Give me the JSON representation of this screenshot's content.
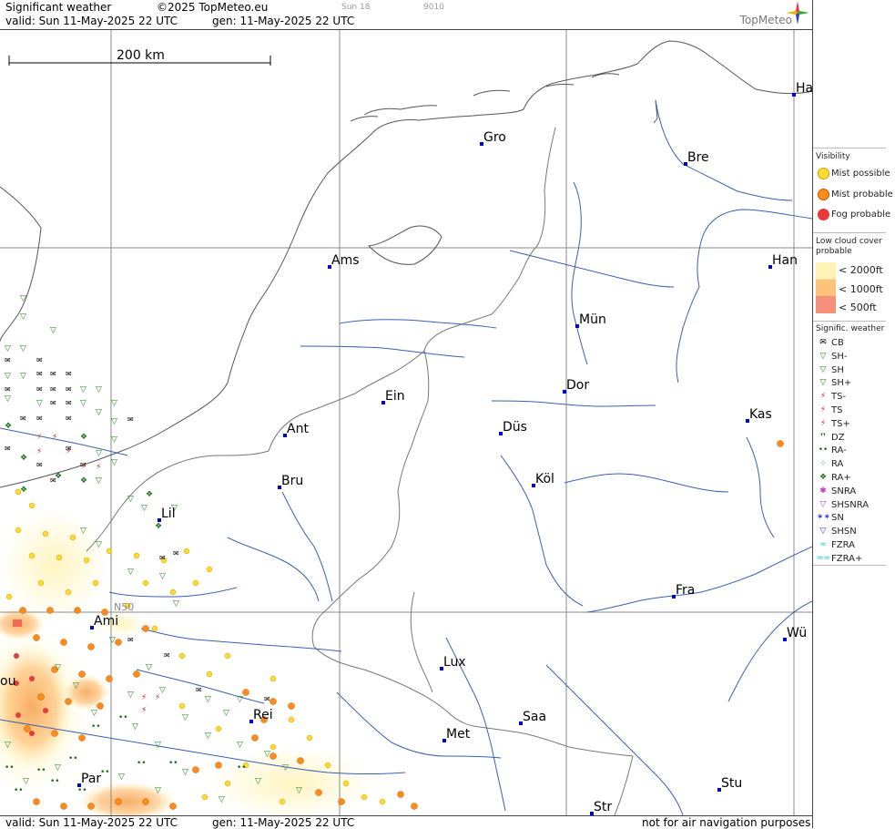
{
  "header": {
    "product": "Significant weather",
    "copyright": "©2025 TopMeteo.eu",
    "day_tag": "Sun 18",
    "code": "9010",
    "valid": "valid:  Sun  11-May-2025  22 UTC",
    "generated": "gen: 11-May-2025 22 UTC",
    "logo": "TopMeteo"
  },
  "footer": {
    "valid": "valid:  Sun  11-May-2025  22 UTC",
    "generated": "gen: 11-May-2025 22 UTC",
    "disclaimer": "not for air navigation purposes"
  },
  "map": {
    "scale_label": "200 km",
    "lat_label": "N50",
    "cities": [
      "Gro",
      "Bre",
      "Ha",
      "Ams",
      "Han",
      "Mün",
      "Dor",
      "Ein",
      "Kas",
      "Ant",
      "Düs",
      "Bru",
      "Köl",
      "Lil",
      "Fra",
      "Ami",
      "Wü",
      "Lux",
      "Rei",
      "Saa",
      "Met",
      "Stu",
      "Par",
      "Str",
      "ou"
    ]
  },
  "legend": {
    "visibility_title": "Visibility",
    "visibility_items": [
      {
        "label": "Mist possible",
        "color": "#ffdd33"
      },
      {
        "label": "Mist probable",
        "color": "#ff8c1a"
      },
      {
        "label": "Fog probable",
        "color": "#e83a3a"
      }
    ],
    "cloud_title": "Low cloud cover probable",
    "cloud_items": [
      {
        "label": "< 2000ft",
        "color": "#fff3b8"
      },
      {
        "label": "< 1000ft",
        "color": "#ffc27a"
      },
      {
        "label": "<  500ft",
        "color": "#f5907a"
      }
    ],
    "weather_title": "Signific. weather",
    "weather_items": [
      {
        "label": "CB",
        "icon": "cb-icon",
        "color": "#000000"
      },
      {
        "label": "SH-",
        "icon": "shower-light-icon",
        "color": "#1e8c1e"
      },
      {
        "label": "SH",
        "icon": "shower-icon",
        "color": "#1e8c1e"
      },
      {
        "label": "SH+",
        "icon": "shower-heavy-icon",
        "color": "#1e8c1e"
      },
      {
        "label": "TS-",
        "icon": "thunderstorm-light-icon",
        "color": "#cc2222"
      },
      {
        "label": "TS",
        "icon": "thunderstorm-icon",
        "color": "#cc2222"
      },
      {
        "label": "TS+",
        "icon": "thunderstorm-heavy-icon",
        "color": "#cc2222"
      },
      {
        "label": "DZ",
        "icon": "drizzle-icon",
        "color": "#1a6e1a"
      },
      {
        "label": "RA-",
        "icon": "rain-light-icon",
        "color": "#1a6e1a"
      },
      {
        "label": "RA",
        "icon": "rain-icon",
        "color": "#1a6e1a"
      },
      {
        "label": "RA+",
        "icon": "rain-heavy-icon",
        "color": "#1a6e1a"
      },
      {
        "label": "SNRA",
        "icon": "snow-rain-icon",
        "color": "#cc33cc"
      },
      {
        "label": "SHSNRA",
        "icon": "snow-rain-shower-icon",
        "color": "#cc33cc"
      },
      {
        "label": "SN",
        "icon": "snow-icon",
        "color": "#2233cc"
      },
      {
        "label": "SHSN",
        "icon": "snow-shower-icon",
        "color": "#2233cc"
      },
      {
        "label": "FZRA",
        "icon": "freezing-rain-icon",
        "color": "#22cccc"
      },
      {
        "label": "FZRA+",
        "icon": "freezing-rain-heavy-icon",
        "color": "#22cccc"
      }
    ]
  }
}
